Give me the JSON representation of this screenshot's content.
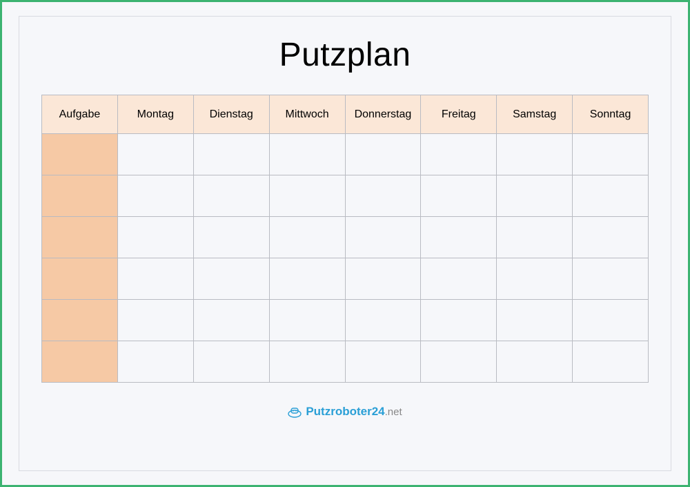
{
  "title": "Putzplan",
  "columns": [
    "Aufgabe",
    "Montag",
    "Dienstag",
    "Mittwoch",
    "Donnerstag",
    "Freitag",
    "Samstag",
    "Sonntag"
  ],
  "row_count": 6,
  "footer": {
    "brand": "Putzroboter24",
    "tld": ".net"
  }
}
